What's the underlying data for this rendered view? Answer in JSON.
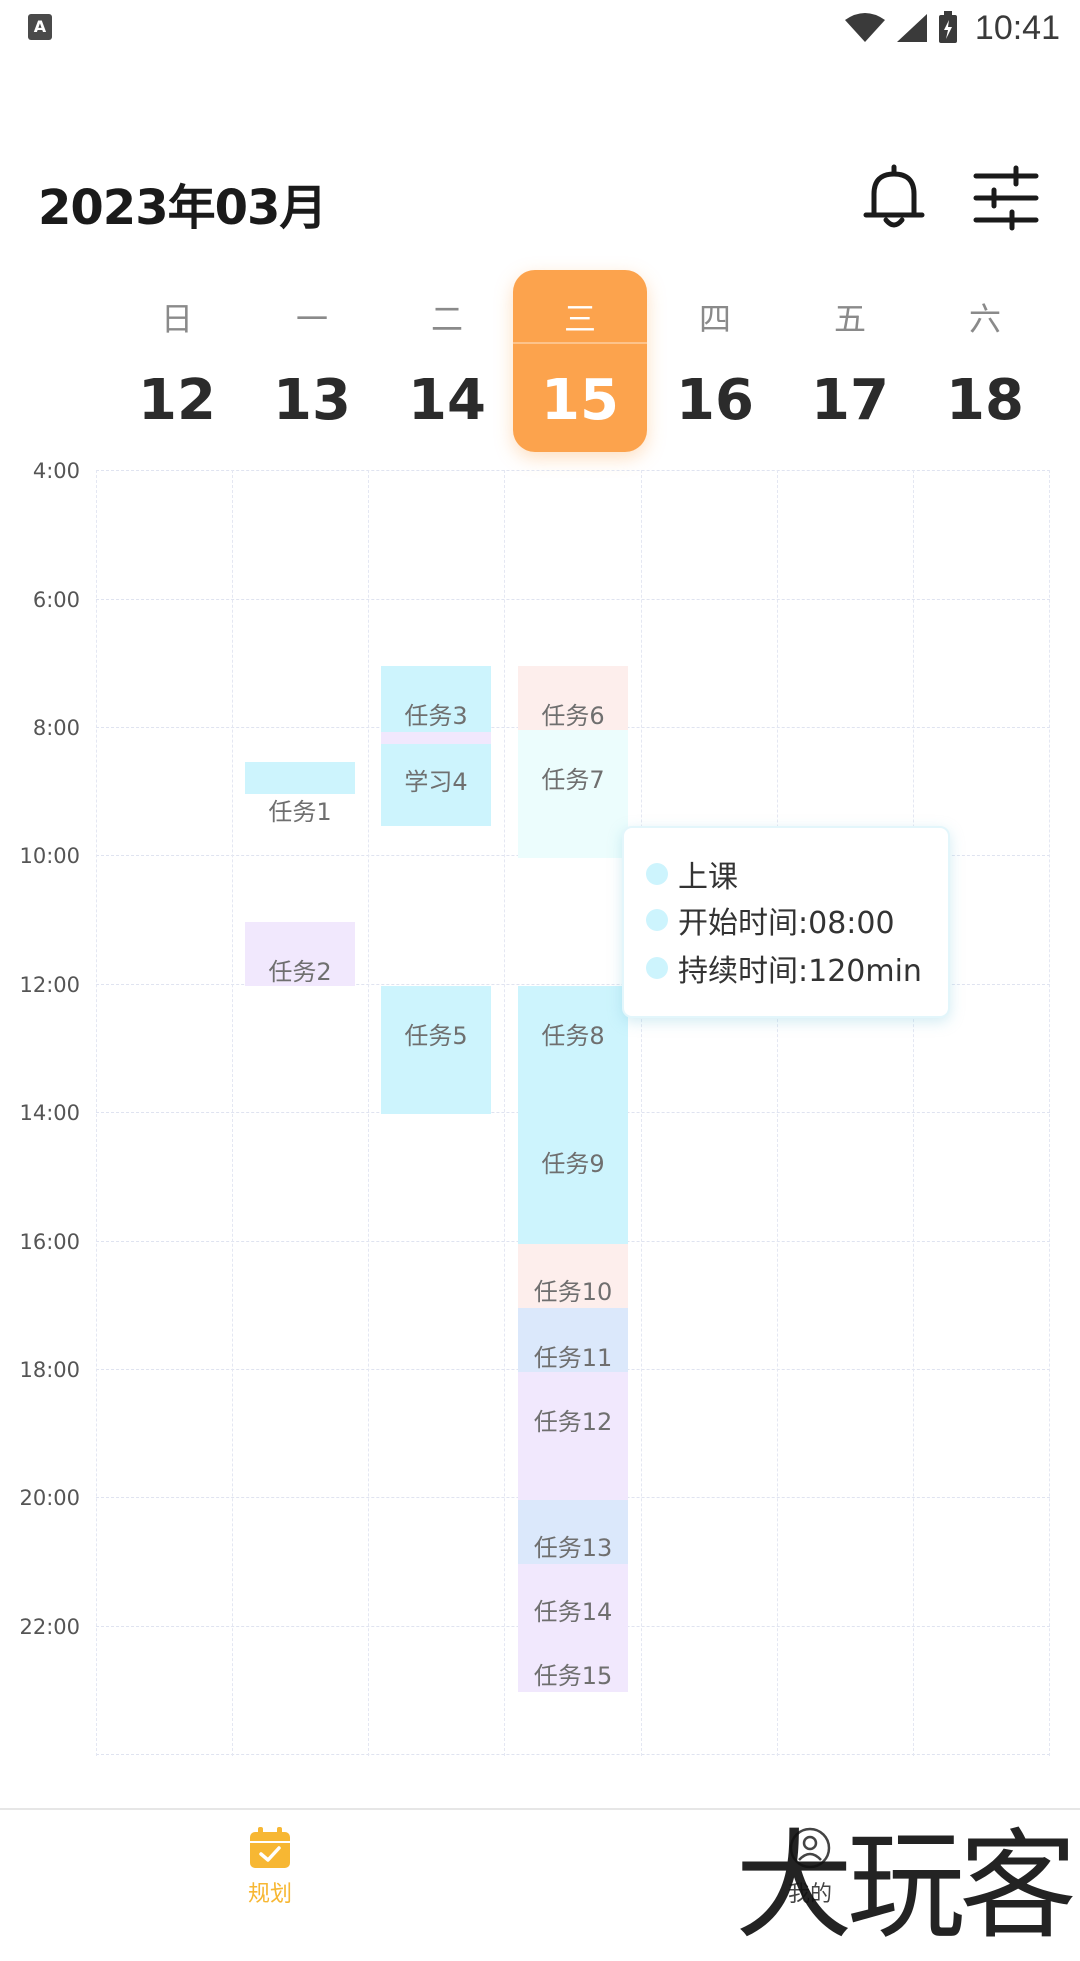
{
  "status_bar": {
    "time": "10:41",
    "app_badge": "A"
  },
  "header": {
    "title": "2023年03月",
    "icons": [
      "bell-icon",
      "filter-settings-icon"
    ]
  },
  "week": {
    "days": [
      {
        "weekday": "日",
        "date": "12"
      },
      {
        "weekday": "一",
        "date": "13"
      },
      {
        "weekday": "二",
        "date": "14"
      },
      {
        "weekday": "三",
        "date": "15",
        "selected": true
      },
      {
        "weekday": "四",
        "date": "16"
      },
      {
        "weekday": "五",
        "date": "17"
      },
      {
        "weekday": "六",
        "date": "18"
      }
    ]
  },
  "time_labels": [
    "4:00",
    "6:00",
    "8:00",
    "10:00",
    "12:00",
    "14:00",
    "16:00",
    "18:00",
    "20:00",
    "22:00"
  ],
  "tasks": [
    {
      "label": "任务1",
      "day": "13",
      "start": "8:30",
      "end": "9:00",
      "color": "#cdf4fd"
    },
    {
      "label": "任务2",
      "day": "13",
      "start": "11:00",
      "end": "12:00",
      "color": "#f1e8fd"
    },
    {
      "label": "任务3",
      "day": "14",
      "start": "7:00",
      "end": "8:00",
      "color": "#cdf4fd"
    },
    {
      "label": "学习4",
      "day": "14",
      "start": "8:00",
      "end": "9:30",
      "color": "#cdf4fd"
    },
    {
      "label": "任务5",
      "day": "14",
      "start": "12:00",
      "end": "14:00",
      "color": "#cdf4fd"
    },
    {
      "label": "任务6",
      "day": "15",
      "start": "7:00",
      "end": "8:00",
      "color": "#fdeeec"
    },
    {
      "label": "任务7",
      "day": "15",
      "start": "8:00",
      "end": "10:00",
      "color": "#ecfdfd"
    },
    {
      "label": "任务8",
      "day": "15",
      "start": "12:00",
      "end": "14:00",
      "color": "#cdf4fd"
    },
    {
      "label": "任务9",
      "day": "15",
      "start": "14:00",
      "end": "16:00",
      "color": "#cdf4fd"
    },
    {
      "label": "任务10",
      "day": "15",
      "start": "16:00",
      "end": "17:00",
      "color": "#fdeeec"
    },
    {
      "label": "任务11",
      "day": "15",
      "start": "17:00",
      "end": "18:00",
      "color": "#dbe8fb"
    },
    {
      "label": "任务12",
      "day": "15",
      "start": "18:00",
      "end": "20:00",
      "color": "#f1e8fd"
    },
    {
      "label": "任务13",
      "day": "15",
      "start": "20:00",
      "end": "21:00",
      "color": "#dbe8fb"
    },
    {
      "label": "任务14",
      "day": "15",
      "start": "21:00",
      "end": "22:00",
      "color": "#f1e8fd"
    },
    {
      "label": "任务15",
      "day": "15",
      "start": "22:00",
      "end": "23:00",
      "color": "#f1e8fd"
    }
  ],
  "tooltip": {
    "rows": [
      "上课",
      "开始时间:08:00",
      "持续时间:120min"
    ]
  },
  "bottom_nav": {
    "items": [
      {
        "label": "规划",
        "icon": "calendar-check-icon",
        "active": true,
        "color": "#f7b733"
      },
      {
        "label": "我的",
        "icon": "user-icon",
        "active": false,
        "color": "#444444"
      }
    ]
  },
  "watermark": "大玩客"
}
